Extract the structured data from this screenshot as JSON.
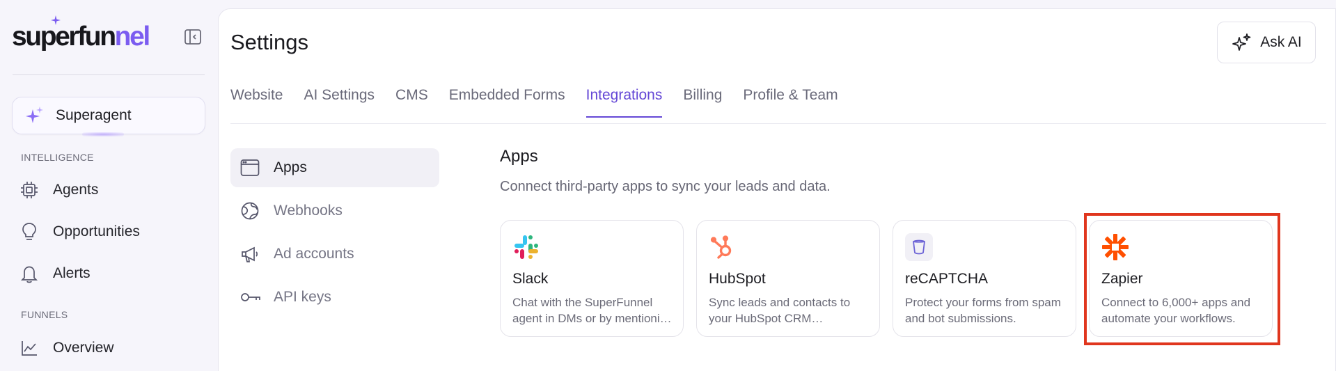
{
  "brand": {
    "logo_main": "superfun",
    "logo_accent": "nel"
  },
  "sidebar": {
    "superagent_label": "Superagent",
    "section_intelligence": "INTELLIGENCE",
    "intelligence_items": [
      {
        "label": "Agents",
        "icon": "chip-icon"
      },
      {
        "label": "Opportunities",
        "icon": "lightbulb-icon"
      },
      {
        "label": "Alerts",
        "icon": "bell-icon"
      }
    ],
    "section_funnels": "FUNNELS",
    "funnels_items": [
      {
        "label": "Overview",
        "icon": "chart-line-icon"
      }
    ]
  },
  "header": {
    "title": "Settings",
    "ask_ai_label": "Ask AI"
  },
  "tabs": [
    {
      "label": "Website"
    },
    {
      "label": "AI Settings"
    },
    {
      "label": "CMS"
    },
    {
      "label": "Embedded Forms"
    },
    {
      "label": "Integrations",
      "active": true
    },
    {
      "label": "Billing"
    },
    {
      "label": "Profile & Team"
    }
  ],
  "subnav": [
    {
      "label": "Apps",
      "icon": "browser-window-icon",
      "active": true
    },
    {
      "label": "Webhooks",
      "icon": "globe-icon"
    },
    {
      "label": "Ad accounts",
      "icon": "megaphone-icon"
    },
    {
      "label": "API keys",
      "icon": "key-icon"
    }
  ],
  "apps": {
    "title": "Apps",
    "description": "Connect third-party apps to sync your leads and data.",
    "cards": [
      {
        "name": "Slack",
        "description": "Chat with the SuperFunnel agent in DMs or by mentioning it in channels.",
        "icon": "slack-icon"
      },
      {
        "name": "HubSpot",
        "description": "Sync leads and contacts to your HubSpot CRM automatically.",
        "icon": "hubspot-icon"
      },
      {
        "name": "reCAPTCHA",
        "description": "Protect your forms from spam and bot submissions.",
        "icon": "recaptcha-icon"
      },
      {
        "name": "Zapier",
        "description": "Connect to 6,000+ apps and automate your workflows.",
        "icon": "zapier-icon",
        "highlighted": true
      }
    ]
  },
  "colors": {
    "accent": "#6548d6",
    "brand_purple": "#7b5cf0",
    "highlight_red": "#e0361e",
    "hubspot_orange": "#ff7a59",
    "zapier_orange": "#ff4f00"
  }
}
